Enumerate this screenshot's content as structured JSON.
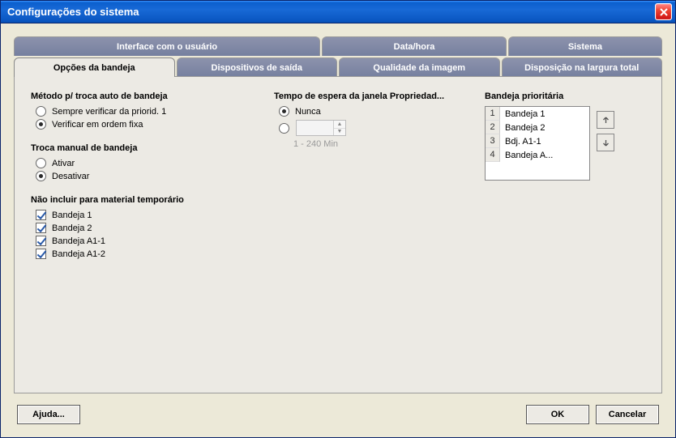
{
  "window": {
    "title": "Configurações do sistema"
  },
  "tabs_row1": {
    "a": "Interface com o usuário",
    "b": "Data/hora",
    "c": "Sistema"
  },
  "tabs_row2": {
    "a": "Opções da bandeja",
    "b": "Dispositivos de saída",
    "c": "Qualidade da imagem",
    "d": "Disposição na largura total"
  },
  "groups": {
    "auto_switch": {
      "title": "Método p/ troca auto de bandeja",
      "opt1": "Sempre verificar da priorid. 1",
      "opt2": "Verificar em ordem fixa"
    },
    "manual_switch": {
      "title": "Troca manual de bandeja",
      "opt1": "Ativar",
      "opt2": "Desativar"
    },
    "exclude": {
      "title": "Não incluir para material temporário",
      "items": [
        "Bandeja 1",
        "Bandeja 2",
        "Bandeja A1-1",
        "Bandeja A1-2"
      ]
    },
    "timeout": {
      "title": "Tempo de espera da janela Propriedad...",
      "opt_never": "Nunca",
      "hint": "1 - 240 Min"
    },
    "priority": {
      "title": "Bandeja prioritária",
      "items": [
        "Bandeja 1",
        "Bandeja 2",
        "Bdj. A1-1",
        "Bandeja A..."
      ]
    }
  },
  "buttons": {
    "help": "Ajuda...",
    "ok": "OK",
    "cancel": "Cancelar"
  }
}
